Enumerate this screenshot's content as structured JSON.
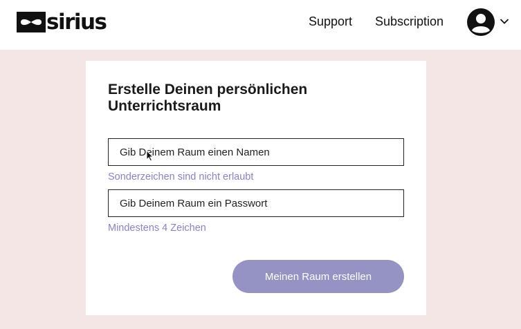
{
  "header": {
    "logo_text": "sirius",
    "nav": {
      "support_label": "Support",
      "subscription_label": "Subscription"
    },
    "avatar_icon": "user-avatar-icon",
    "dropdown_icon": "chevron-down-icon"
  },
  "form": {
    "title": "Erstelle Deinen persönlichen Unterrichtsraum",
    "name_field": {
      "placeholder": "Gib Deinem Raum einen Namen",
      "value": "",
      "hint": "Sonderzeichen sind nicht erlaubt"
    },
    "password_field": {
      "placeholder": "Gib Deinem Raum ein Passwort",
      "value": "",
      "hint": "Mindestens 4 Zeichen"
    },
    "submit_label": "Meinen Raum erstellen"
  },
  "colors": {
    "background": "#f5e6e6",
    "hint": "#8a82c8",
    "button": "#9593c3",
    "text": "#111111"
  }
}
